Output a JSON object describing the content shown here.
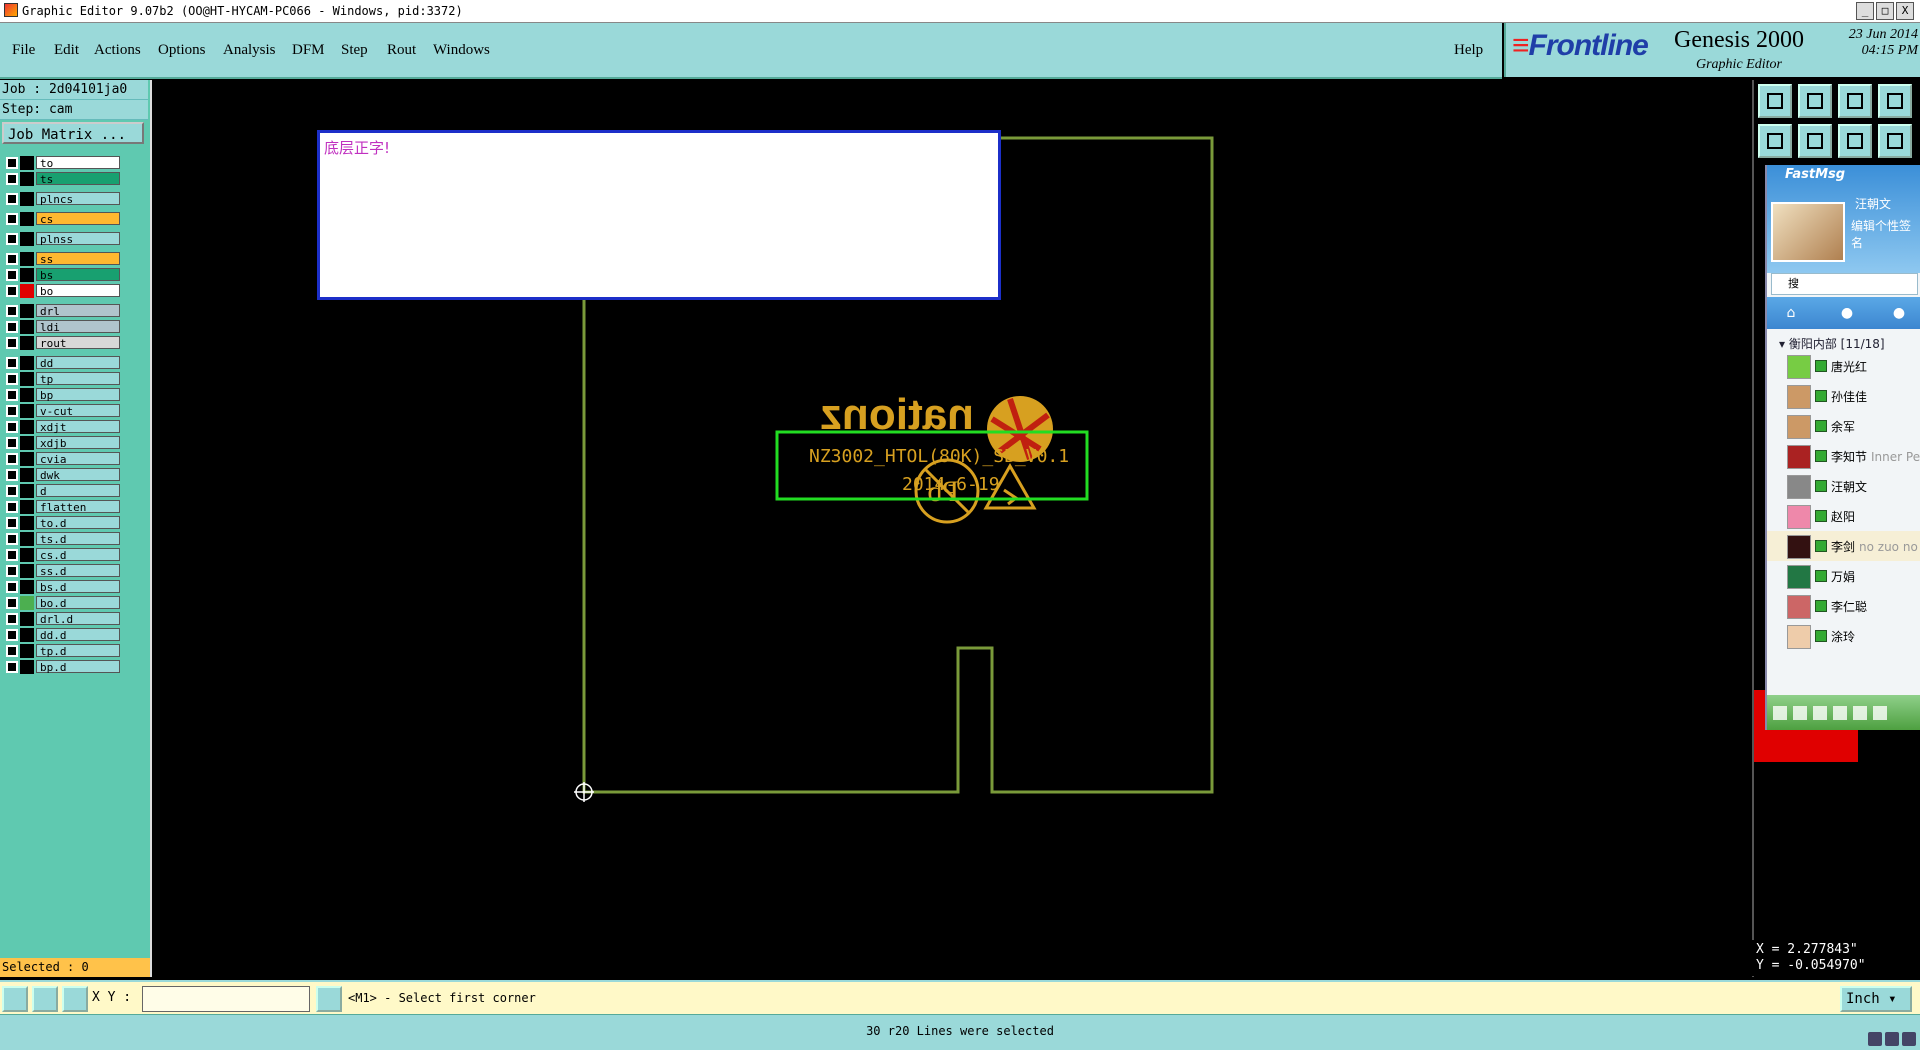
{
  "window": {
    "title": "Graphic Editor 9.07b2 (OO@HT-HYCAM-PC066 - Windows, pid:3372)",
    "buttons": [
      "_",
      "□",
      "X"
    ]
  },
  "menu": {
    "items": [
      "File",
      "Edit",
      "Actions",
      "Options",
      "Analysis",
      "DFM",
      "Step",
      "Rout",
      "Windows"
    ],
    "help": "Help"
  },
  "brand": {
    "logo_prefix": "≡",
    "logo": "Frontline",
    "product": "Genesis 2000",
    "subtitle": "Graphic Editor",
    "date": "23 Jun 2014",
    "time": "04:15 PM"
  },
  "job": {
    "job_line": "Job : 2d04101ja0",
    "step_line": "Step: cam",
    "matrix_button": "Job Matrix ..."
  },
  "layers": [
    {
      "name": "to",
      "color": "#ffffff",
      "swatch": "#000000"
    },
    {
      "name": "ts",
      "color": "#18a070",
      "swatch": "#000000"
    },
    {
      "name": "plncs",
      "color": "#9ad9d9",
      "swatch": "#000000"
    },
    {
      "name": "cs",
      "color": "#ffb830",
      "swatch": "#000000"
    },
    {
      "name": "plnss",
      "color": "#9ad9d9",
      "swatch": "#000000"
    },
    {
      "name": "ss",
      "color": "#ffb830",
      "swatch": "#000000"
    },
    {
      "name": "bs",
      "color": "#18a070",
      "swatch": "#000000"
    },
    {
      "name": "bo",
      "color": "#ffffff",
      "swatch": "#e00000"
    },
    {
      "name": "drl",
      "color": "#b0c4cc",
      "swatch": "#000000"
    },
    {
      "name": "ldi",
      "color": "#b0c4cc",
      "swatch": "#000000"
    },
    {
      "name": "rout",
      "color": "#d8d8d8",
      "swatch": "#000000"
    },
    {
      "name": "dd",
      "color": "#9ad9d9",
      "swatch": "#000000"
    },
    {
      "name": "tp",
      "color": "#9ad9d9",
      "swatch": "#000000"
    },
    {
      "name": "bp",
      "color": "#9ad9d9",
      "swatch": "#000000"
    },
    {
      "name": "v-cut",
      "color": "#9ad9d9",
      "swatch": "#000000"
    },
    {
      "name": "xdjt",
      "color": "#9ad9d9",
      "swatch": "#000000"
    },
    {
      "name": "xdjb",
      "color": "#9ad9d9",
      "swatch": "#000000"
    },
    {
      "name": "cvia",
      "color": "#9ad9d9",
      "swatch": "#000000"
    },
    {
      "name": "dwk",
      "color": "#9ad9d9",
      "swatch": "#000000"
    },
    {
      "name": "d",
      "color": "#9ad9d9",
      "swatch": "#000000"
    },
    {
      "name": "flatten",
      "color": "#9ad9d9",
      "swatch": "#000000"
    },
    {
      "name": "to.d",
      "color": "#9ad9d9",
      "swatch": "#000000"
    },
    {
      "name": "ts.d",
      "color": "#9ad9d9",
      "swatch": "#000000"
    },
    {
      "name": "cs.d",
      "color": "#9ad9d9",
      "swatch": "#000000"
    },
    {
      "name": "ss.d",
      "color": "#9ad9d9",
      "swatch": "#000000"
    },
    {
      "name": "bs.d",
      "color": "#9ad9d9",
      "swatch": "#000000"
    },
    {
      "name": "bo.d",
      "color": "#9ad9d9",
      "swatch": "#4caf50"
    },
    {
      "name": "drl.d",
      "color": "#9ad9d9",
      "swatch": "#000000"
    },
    {
      "name": "dd.d",
      "color": "#9ad9d9",
      "swatch": "#000000"
    },
    {
      "name": "tp.d",
      "color": "#9ad9d9",
      "swatch": "#000000"
    },
    {
      "name": "bp.d",
      "color": "#9ad9d9",
      "swatch": "#000000"
    }
  ],
  "selected": "Selected : 0",
  "canvas": {
    "note": "底层正字!",
    "logo_text": "nationz",
    "board_name": "NZ3002_HTOL(80K)_SB_V0.1",
    "board_date": "2014-6-19",
    "pb_symbol": "Pb",
    "outline_color": "#7a9a3a",
    "text_color": "#d7a020",
    "frame_color": "#22dd22"
  },
  "coords": {
    "x": "X = 2.277843\"",
    "y": "Y = -0.054970\""
  },
  "fastmsg": {
    "title": "FastMsg",
    "user": "汪朝文",
    "signature": "编辑个性签名",
    "search_placeholder": "搜",
    "tabs_icons": [
      "home-icon",
      "contact-icon",
      "group-icon"
    ],
    "group": "衡阳内部 [11/18]",
    "contacts": [
      {
        "name": "唐光红",
        "note": ""
      },
      {
        "name": "孙佳佳",
        "note": ""
      },
      {
        "name": "余军",
        "note": ""
      },
      {
        "name": "李知节",
        "note": "Inner Pe"
      },
      {
        "name": "汪朝文",
        "note": ""
      },
      {
        "name": "赵阳",
        "note": ""
      },
      {
        "name": "李剑",
        "note": "no zuo no"
      },
      {
        "name": "万娟",
        "note": ""
      },
      {
        "name": "李仁聪",
        "note": ""
      },
      {
        "name": "涂玲",
        "note": ""
      }
    ]
  },
  "command": {
    "xy_label": "X Y :",
    "xy_value": "",
    "prompt": "<M1> - Select first corner",
    "units": "Inch"
  },
  "status": "30 r20 Lines were selected"
}
